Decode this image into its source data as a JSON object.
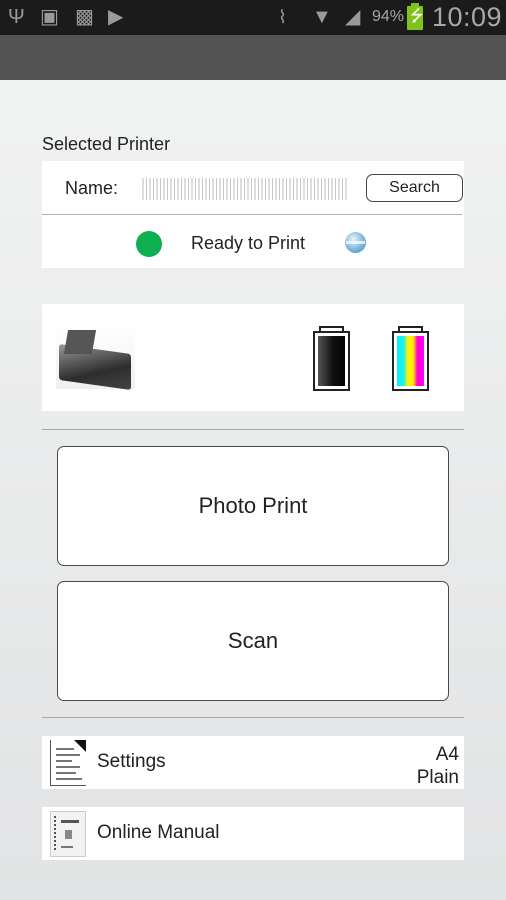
{
  "status_bar": {
    "notification_icons": [
      "usb-icon",
      "image-icon",
      "sim-card-icon",
      "play-store-icon"
    ],
    "system_icons": [
      "vibrate-mute-icon",
      "wifi-icon",
      "signal-icon"
    ],
    "battery_percent": "94%",
    "battery_charging": true,
    "battery_color": "#7fc31c",
    "time": "10:09"
  },
  "selected_printer": {
    "section_title": "Selected Printer",
    "name_label": "Name:",
    "name_value": "[redacted]",
    "search_label": "Search",
    "status_text": "Ready to Print",
    "status_color": "#0eaf50"
  },
  "ink": {
    "cartridges": [
      {
        "name": "black",
        "level": 1.0
      },
      {
        "name": "color",
        "level": 1.0
      }
    ]
  },
  "actions": {
    "photo_print_label": "Photo Print",
    "scan_label": "Scan"
  },
  "settings": {
    "label": "Settings",
    "paper_size": "A4",
    "paper_type": "Plain"
  },
  "manual": {
    "label": "Online Manual"
  }
}
